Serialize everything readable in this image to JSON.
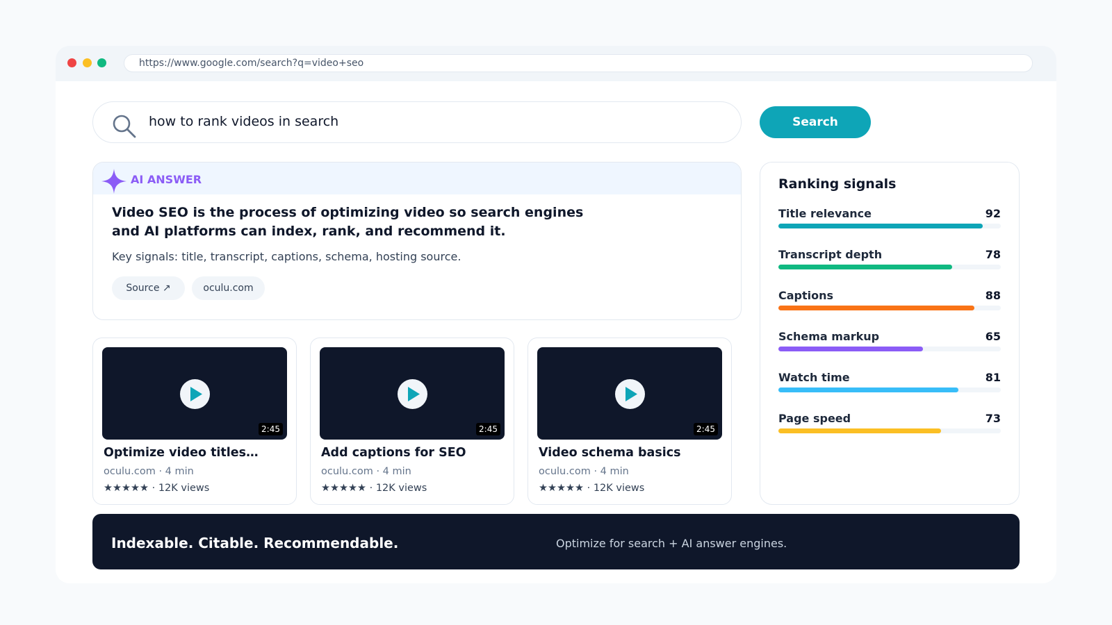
{
  "browser": {
    "url": "https://www.google.com/search?q=video+seo"
  },
  "search": {
    "query": "how to rank videos in search",
    "button_label": "Search"
  },
  "ai_answer": {
    "label": "AI ANSWER",
    "headline": "Video SEO is the process of optimizing video so search engines and AI platforms can index, rank, and recommend it.",
    "subtext": "Key signals: title, transcript, captions, schema, hosting source.",
    "chips": [
      "Source ↗",
      "oculu.com"
    ]
  },
  "videos": [
    {
      "title": "Optimize video titles…",
      "duration": "2:45",
      "meta": "oculu.com · 4 min",
      "stats": "★★★★★ · 12K views"
    },
    {
      "title": "Add captions for SEO",
      "duration": "2:45",
      "meta": "oculu.com · 4 min",
      "stats": "★★★★★ · 12K views"
    },
    {
      "title": "Video schema basics",
      "duration": "2:45",
      "meta": "oculu.com · 4 min",
      "stats": "★★★★★ · 12K views"
    }
  ],
  "ranking": {
    "title": "Ranking signals",
    "max": 100,
    "signals": [
      {
        "label": "Title relevance",
        "score": 92,
        "color": "#0ea5b7"
      },
      {
        "label": "Transcript depth",
        "score": 78,
        "color": "#10b981"
      },
      {
        "label": "Captions",
        "score": 88,
        "color": "#f97316"
      },
      {
        "label": "Schema markup",
        "score": 65,
        "color": "#8b5cf6"
      },
      {
        "label": "Watch time",
        "score": 81,
        "color": "#38bdf8"
      },
      {
        "label": "Page speed",
        "score": 73,
        "color": "#fbbf24"
      }
    ]
  },
  "banner": {
    "title": "Indexable. Citable. Recommendable.",
    "subtitle": "Optimize for search + AI answer engines."
  },
  "colors": {
    "accent": "#0ea5b7",
    "ai_purple": "#8b5cf6",
    "dark": "#0f172a"
  }
}
